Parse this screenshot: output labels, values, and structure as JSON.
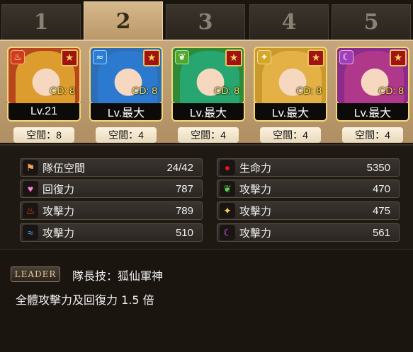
{
  "tabs": [
    {
      "label": "1",
      "active": false
    },
    {
      "label": "2",
      "active": true
    },
    {
      "label": "3",
      "active": false
    },
    {
      "label": "4",
      "active": false
    },
    {
      "label": "5",
      "active": false
    }
  ],
  "cards": [
    {
      "element": "fire",
      "element_color": "#d33a16",
      "hair_color": "#e0a531",
      "border": "#f5d778",
      "bg": "#b8461c",
      "cd": "CD: 8",
      "level": "Lv.21",
      "space": "空間：8"
    },
    {
      "element": "water",
      "element_color": "#2a7dd6",
      "hair_color": "#2c7bd1",
      "border": "#f5d778",
      "bg": "#2d6fb7",
      "cd": "CD: 8",
      "level": "Lv.最大",
      "space": "空間：4"
    },
    {
      "element": "wood",
      "element_color": "#4fa82a",
      "hair_color": "#27a877",
      "border": "#f5d778",
      "bg": "#2f8a38",
      "cd": "CD: 8",
      "level": "Lv.最大",
      "space": "空間：4"
    },
    {
      "element": "light",
      "element_color": "#d8a625",
      "hair_color": "#e7b44a",
      "border": "#f5d778",
      "bg": "#c99a2b",
      "cd": "CD: 8",
      "level": "Lv.最大",
      "space": "空間：4"
    },
    {
      "element": "dark",
      "element_color": "#a23fb8",
      "hair_color": "#b43a89",
      "border": "#f5d778",
      "bg": "#8b2b8c",
      "cd": "CD: 8",
      "level": "Lv.最大",
      "space": "空間：4"
    }
  ],
  "stats": {
    "left": [
      {
        "icon": "flag-icon",
        "glyph": "⚑",
        "color": "#f0a35a",
        "label": "隊伍空間",
        "value": "24/42"
      },
      {
        "icon": "heart-icon",
        "glyph": "♥",
        "color": "#ff7fd0",
        "label": "回復力",
        "value": "787"
      },
      {
        "icon": "fire-icon",
        "glyph": "♨",
        "color": "#ff5a1f",
        "label": "攻擊力",
        "value": "789"
      },
      {
        "icon": "water-icon",
        "glyph": "≈",
        "color": "#3fa9ff",
        "label": "攻擊力",
        "value": "510"
      }
    ],
    "right": [
      {
        "icon": "blood-drop-icon",
        "glyph": "●",
        "color": "#e01818",
        "label": "生命力",
        "value": "5350"
      },
      {
        "icon": "wood-icon",
        "glyph": "❦",
        "color": "#5fd04a",
        "label": "攻擊力",
        "value": "470"
      },
      {
        "icon": "light-icon",
        "glyph": "✦",
        "color": "#ffd24a",
        "label": "攻擊力",
        "value": "475"
      },
      {
        "icon": "dark-moon-icon",
        "glyph": "☾",
        "color": "#c45cf0",
        "label": "攻擊力",
        "value": "561"
      }
    ]
  },
  "leader": {
    "badge": "LEADER",
    "title": "隊長技：狐仙軍神",
    "description": "全體攻擊力及回復力 1.5 倍"
  }
}
